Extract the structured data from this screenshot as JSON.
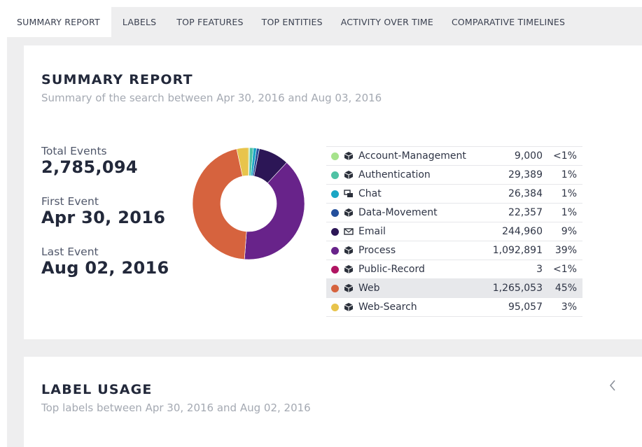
{
  "tabs": [
    {
      "label": "SUMMARY REPORT",
      "active": true
    },
    {
      "label": "LABELS",
      "active": false
    },
    {
      "label": "TOP FEATURES",
      "active": false
    },
    {
      "label": "TOP ENTITIES",
      "active": false
    },
    {
      "label": "ACTIVITY OVER TIME",
      "active": false
    },
    {
      "label": "COMPARATIVE TIMELINES",
      "active": false
    }
  ],
  "summary": {
    "title": "SUMMARY REPORT",
    "subtitle": "Summary of the search between Apr 30, 2016 and Aug 03, 2016",
    "total_events_label": "Total Events",
    "total_events_value": "2,785,094",
    "first_event_label": "First Event",
    "first_event_value": "Apr 30, 2016",
    "last_event_label": "Last Event",
    "last_event_value": "Aug 02, 2016"
  },
  "chart_data": {
    "type": "pie",
    "categories": [
      "Account-Management",
      "Authentication",
      "Chat",
      "Data-Movement",
      "Email",
      "Process",
      "Public-Record",
      "Web",
      "Web-Search"
    ],
    "values": [
      9000,
      29389,
      26384,
      22357,
      244960,
      1092891,
      3,
      1265053,
      95057
    ],
    "colors": [
      "#a6e38c",
      "#4fc2a4",
      "#1aa6c4",
      "#234f9c",
      "#2c1656",
      "#68238a",
      "#b01462",
      "#d6633e",
      "#e8c44c"
    ]
  },
  "legend_rows": [
    {
      "name": "Account-Management",
      "count": "9,000",
      "pct": "<1%",
      "icon": "cube-icon",
      "color": "#a6e38c"
    },
    {
      "name": "Authentication",
      "count": "29,389",
      "pct": "1%",
      "icon": "cube-icon",
      "color": "#4fc2a4"
    },
    {
      "name": "Chat",
      "count": "26,384",
      "pct": "1%",
      "icon": "chat-icon",
      "color": "#1aa6c4"
    },
    {
      "name": "Data-Movement",
      "count": "22,357",
      "pct": "1%",
      "icon": "cube-icon",
      "color": "#234f9c"
    },
    {
      "name": "Email",
      "count": "244,960",
      "pct": "9%",
      "icon": "envelope-icon",
      "color": "#2c1656"
    },
    {
      "name": "Process",
      "count": "1,092,891",
      "pct": "39%",
      "icon": "cube-icon",
      "color": "#68238a"
    },
    {
      "name": "Public-Record",
      "count": "3",
      "pct": "<1%",
      "icon": "cube-icon",
      "color": "#b01462"
    },
    {
      "name": "Web",
      "count": "1,265,053",
      "pct": "45%",
      "icon": "cube-icon",
      "color": "#d6633e",
      "highlighted": true
    },
    {
      "name": "Web-Search",
      "count": "95,057",
      "pct": "3%",
      "icon": "cube-icon",
      "color": "#e8c44c"
    }
  ],
  "label_usage": {
    "title": "LABEL USAGE",
    "subtitle": "Top labels between Apr 30, 2016 and Aug 02, 2016",
    "collapse_icon": "chevron-left-icon"
  }
}
